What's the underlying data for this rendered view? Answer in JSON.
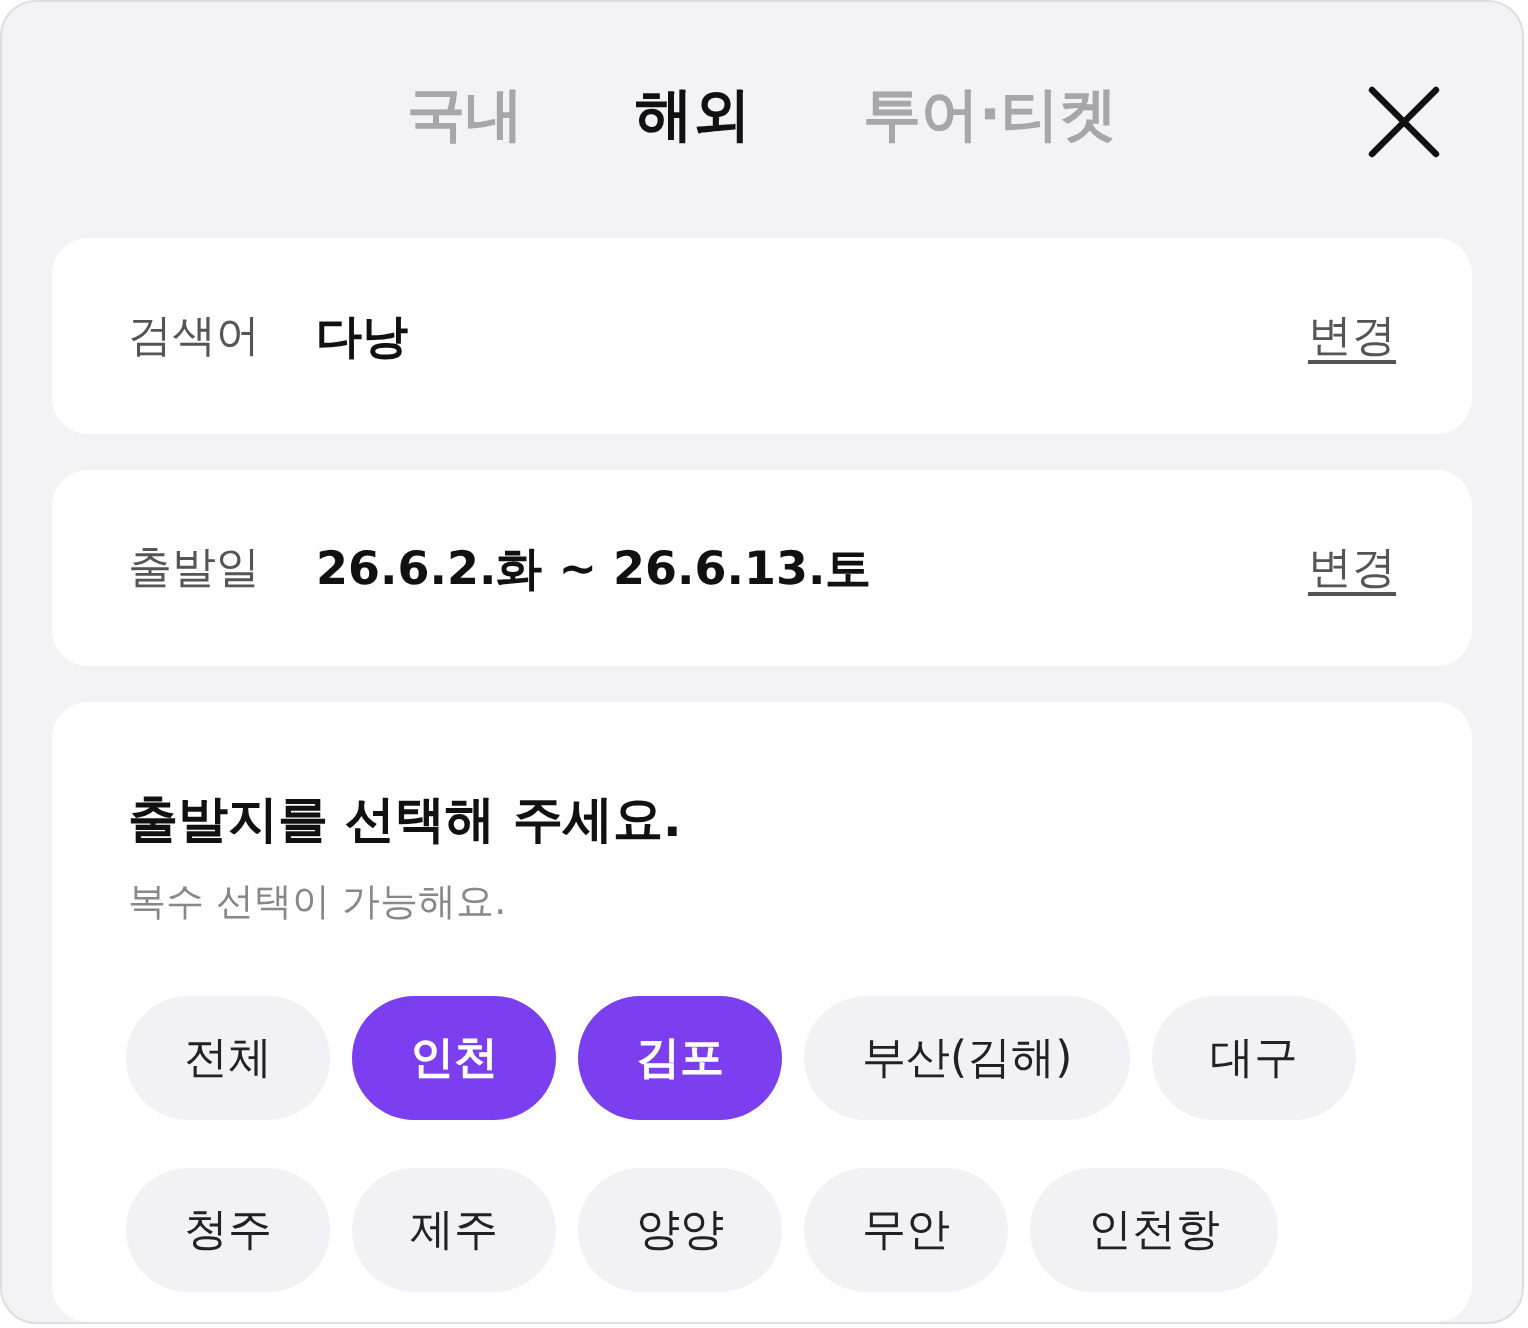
{
  "tabs": [
    {
      "label": "국내",
      "selected": false
    },
    {
      "label": "해외",
      "selected": true
    },
    {
      "label": "투어·티켓",
      "selected": false
    }
  ],
  "fields": [
    {
      "label": "검색어",
      "value": "다낭",
      "action": "변경"
    },
    {
      "label": "출발일",
      "value": "26.6.2.화 ~ 26.6.13.토",
      "action": "변경"
    }
  ],
  "departure": {
    "title": "출발지를 선택해 주세요.",
    "subtitle": "복수 선택이 가능해요.",
    "chips": [
      {
        "label": "전체",
        "selected": false
      },
      {
        "label": "인천",
        "selected": true
      },
      {
        "label": "김포",
        "selected": true
      },
      {
        "label": "부산(김해)",
        "selected": false
      },
      {
        "label": "대구",
        "selected": false
      },
      {
        "label": "청주",
        "selected": false
      },
      {
        "label": "제주",
        "selected": false
      },
      {
        "label": "양양",
        "selected": false
      },
      {
        "label": "무안",
        "selected": false
      },
      {
        "label": "인천항",
        "selected": false
      }
    ]
  }
}
